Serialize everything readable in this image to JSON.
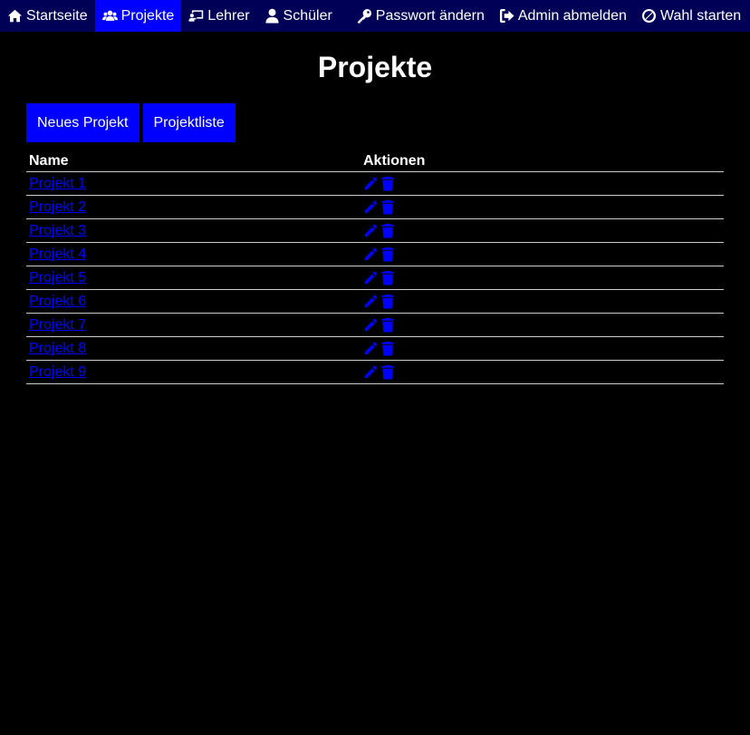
{
  "nav": {
    "items": [
      {
        "label": "Startseite",
        "icon": "home-icon"
      },
      {
        "label": "Projekte",
        "icon": "users-icon",
        "active": true
      },
      {
        "label": "Lehrer",
        "icon": "chalkboard-teacher-icon"
      },
      {
        "label": "Schüler",
        "icon": "user-icon"
      },
      {
        "label": "Passwort ändern",
        "icon": "key-icon"
      },
      {
        "label": "Admin abmelden",
        "icon": "sign-out-icon"
      },
      {
        "label": "Wahl starten",
        "icon": "ban-icon"
      }
    ]
  },
  "page": {
    "title": "Projekte"
  },
  "buttons": {
    "new_project": "Neues Projekt",
    "project_list": "Projektliste"
  },
  "table": {
    "headers": {
      "name": "Name",
      "actions": "Aktionen"
    },
    "rows": [
      {
        "name": "Projekt 1"
      },
      {
        "name": "Projekt 2"
      },
      {
        "name": "Projekt 3"
      },
      {
        "name": "Projekt 4"
      },
      {
        "name": "Projekt 5"
      },
      {
        "name": "Projekt 6"
      },
      {
        "name": "Projekt 7"
      },
      {
        "name": "Projekt 8"
      },
      {
        "name": "Projekt 9"
      }
    ]
  },
  "colors": {
    "navbar_bg": "#000057",
    "accent": "#0000ff",
    "background": "#000000",
    "text": "#ffffff"
  }
}
